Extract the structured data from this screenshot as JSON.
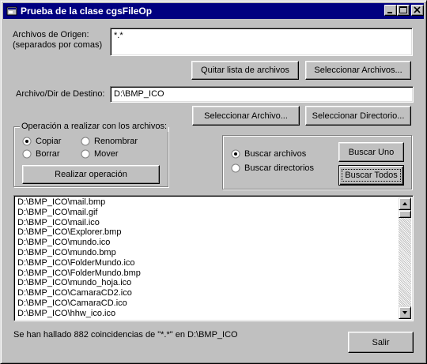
{
  "window": {
    "title": "Prueba de la clase cgsFileOp",
    "controls": [
      "minimize-icon",
      "maximize-icon",
      "close-icon"
    ]
  },
  "source": {
    "label_line1": "Archivos de Origen:",
    "label_line2": "(separados por comas)",
    "value": "*.*",
    "clear_button": "Quitar lista de archivos",
    "select_button": "Seleccionar Archivos..."
  },
  "destination": {
    "label": "Archivo/Dir de Destino:",
    "value": "D:\\BMP_ICO",
    "select_file_button": "Seleccionar Archivo...",
    "select_dir_button": "Seleccionar Directorio..."
  },
  "operation": {
    "group_label": "Operación a realizar con los archivos:",
    "options": [
      "Copiar",
      "Renombrar",
      "Borrar",
      "Mover"
    ],
    "selected": "Copiar",
    "run_button": "Realizar operación"
  },
  "search": {
    "options": [
      "Buscar archivos",
      "Buscar directorios"
    ],
    "selected": "Buscar archivos",
    "find_one_button": "Buscar Uno",
    "find_all_button": "Buscar Todos"
  },
  "results": {
    "items": [
      "D:\\BMP_ICO\\mail.bmp",
      "D:\\BMP_ICO\\mail.gif",
      "D:\\BMP_ICO\\mail.ico",
      "D:\\BMP_ICO\\Explorer.bmp",
      "D:\\BMP_ICO\\mundo.ico",
      "D:\\BMP_ICO\\mundo.bmp",
      "D:\\BMP_ICO\\FolderMundo.ico",
      "D:\\BMP_ICO\\FolderMundo.bmp",
      "D:\\BMP_ICO\\mundo_hoja.ico",
      "D:\\BMP_ICO\\CamaraCD2.ico",
      "D:\\BMP_ICO\\CamaraCD.ico",
      "D:\\BMP_ICO\\hhw_ico.ico"
    ]
  },
  "status": {
    "text": "Se han hallado 882 coincidencias de \"*.*\" en D:\\BMP_ICO"
  },
  "exit_button": "Salir",
  "colors": {
    "title_bar": "#000080",
    "face": "#c0c0c0",
    "field": "#ffffff"
  }
}
